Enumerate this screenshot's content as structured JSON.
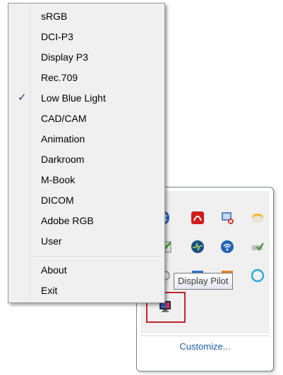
{
  "context_menu": {
    "items": [
      {
        "label": "sRGB",
        "checked": false
      },
      {
        "label": "DCI-P3",
        "checked": false
      },
      {
        "label": "Display P3",
        "checked": false
      },
      {
        "label": "Rec.709",
        "checked": false
      },
      {
        "label": "Low Blue Light",
        "checked": true
      },
      {
        "label": "CAD/CAM",
        "checked": false
      },
      {
        "label": "Animation",
        "checked": false
      },
      {
        "label": "Darkroom",
        "checked": false
      },
      {
        "label": "M-Book",
        "checked": false
      },
      {
        "label": "DICOM",
        "checked": false
      },
      {
        "label": "Adobe RGB",
        "checked": false
      },
      {
        "label": "User",
        "checked": false
      }
    ],
    "footer_items": [
      {
        "label": "About"
      },
      {
        "label": "Exit"
      }
    ],
    "check_glyph": "✓"
  },
  "tooltip": {
    "text": "Display Pilot"
  },
  "tray": {
    "customize_label": "Customize...",
    "icons": [
      "bluetooth-icon",
      "acrobat-icon",
      "network-monitor-icon",
      "storage-icon",
      "edit-icon",
      "activity-monitor-icon",
      "wifi-icon",
      "drive-check-icon",
      "speaker-icon",
      "display-icon",
      "orange-app-icon",
      "skype-icon",
      "display-pilot-icon"
    ],
    "highlight_color": "#c1232a"
  }
}
